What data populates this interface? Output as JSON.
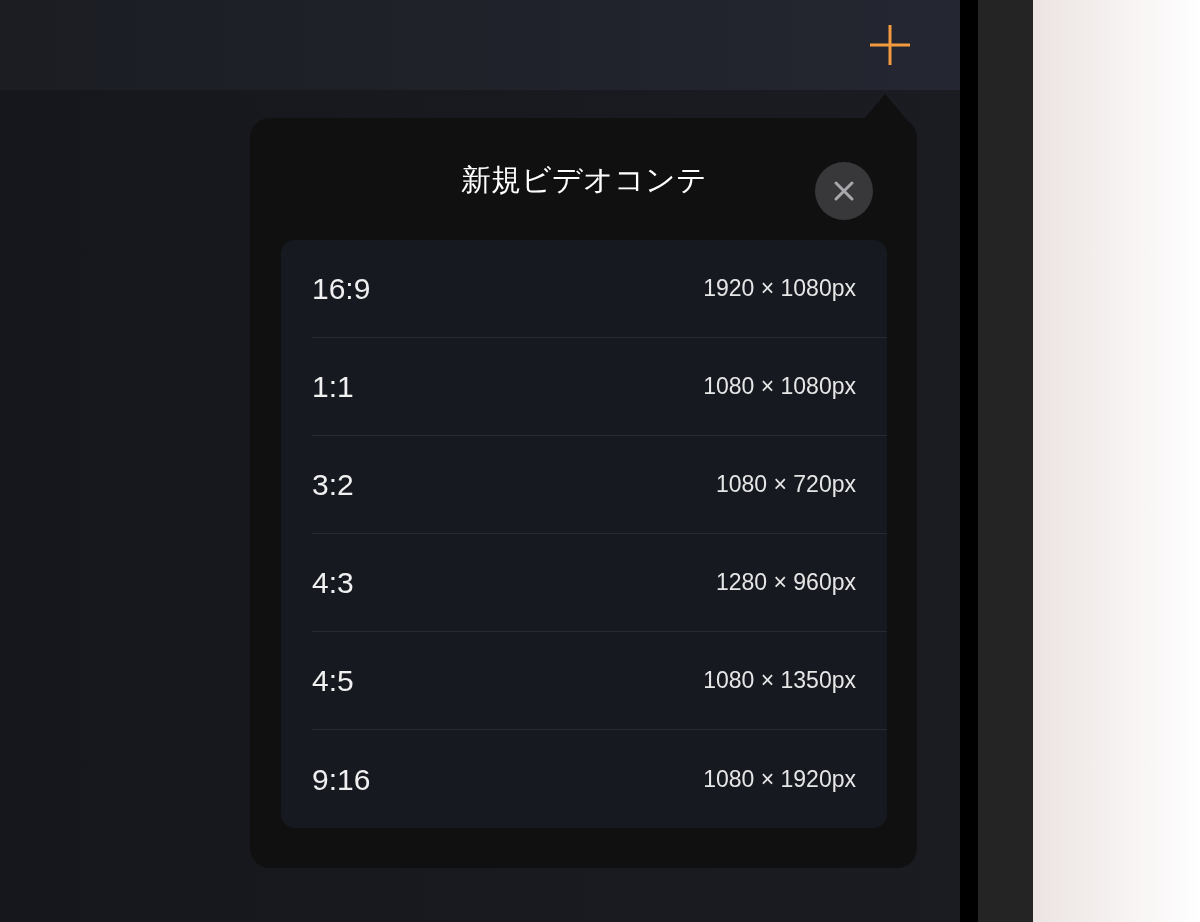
{
  "popover": {
    "title": "新規ビデオコンテ",
    "options": [
      {
        "ratio": "16:9",
        "size": "1920 × 1080px"
      },
      {
        "ratio": "1:1",
        "size": "1080 × 1080px"
      },
      {
        "ratio": "3:2",
        "size": "1080 × 720px"
      },
      {
        "ratio": "4:3",
        "size": "1280 × 960px"
      },
      {
        "ratio": "4:5",
        "size": "1080 × 1350px"
      },
      {
        "ratio": "9:16",
        "size": "1080 × 1920px"
      }
    ]
  }
}
